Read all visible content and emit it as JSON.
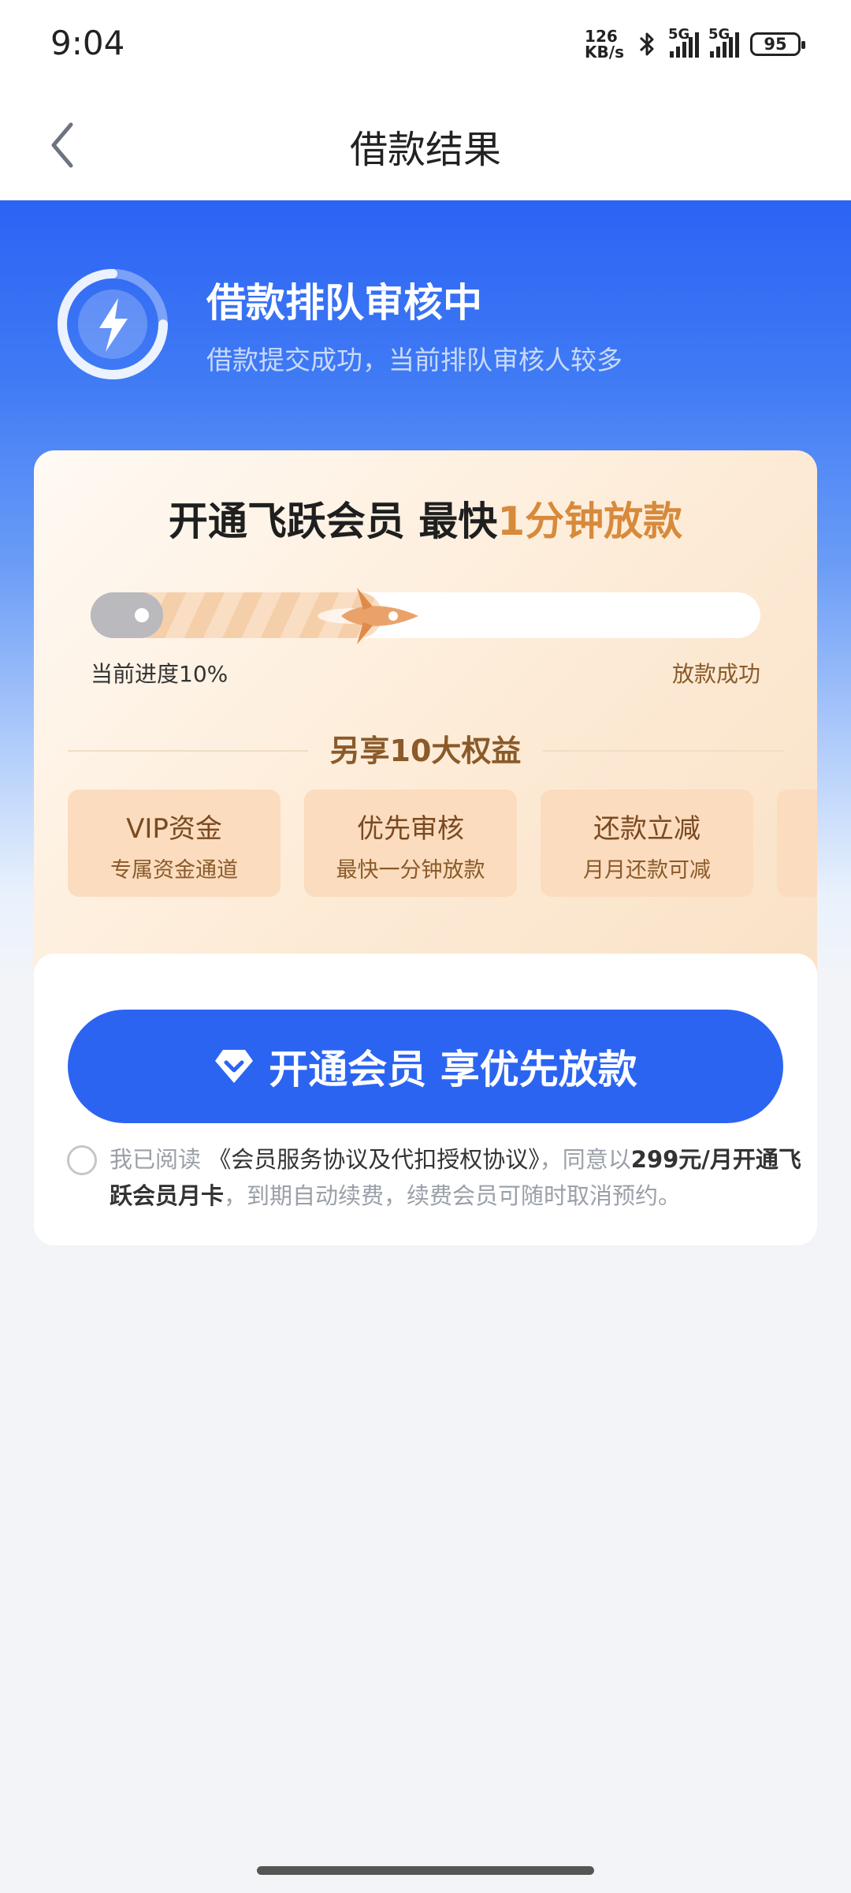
{
  "status_bar": {
    "time": "9:04",
    "net_speed_value": "126",
    "net_speed_unit": "KB/s",
    "sim1_label": "5G",
    "sim2_label": "5G",
    "battery": "95"
  },
  "header": {
    "title": "借款结果"
  },
  "hero": {
    "title": "借款排队审核中",
    "subtitle": "借款提交成功，当前排队审核人较多"
  },
  "member_card": {
    "title_prefix": "开通飞跃会员 最快",
    "title_highlight": "1分钟放款",
    "progress": {
      "value": 0.1,
      "left_label": "当前进度10%",
      "right_label": "放款成功"
    },
    "benefits_title": "另享10大权益",
    "benefits": [
      {
        "title": "VIP资金",
        "desc": "专属资金通道"
      },
      {
        "title": "优先审核",
        "desc": "最快一分钟放款"
      },
      {
        "title": "还款立减",
        "desc": "月月还款可减"
      }
    ]
  },
  "action": {
    "button_label": "开通会员 享优先放款",
    "agreement": {
      "prefix": "我已阅读",
      "link": "《会员服务协议及代扣授权协议》",
      "middle": "，同意以",
      "price": "299元/月开通飞跃会员月卡",
      "suffix": "，到期自动续费，续费会员可随时取消预约。"
    }
  },
  "colors": {
    "primary": "#2c64f2",
    "accent_gold": "#d78a3b",
    "benefit_bg": "#fbdcbe"
  }
}
